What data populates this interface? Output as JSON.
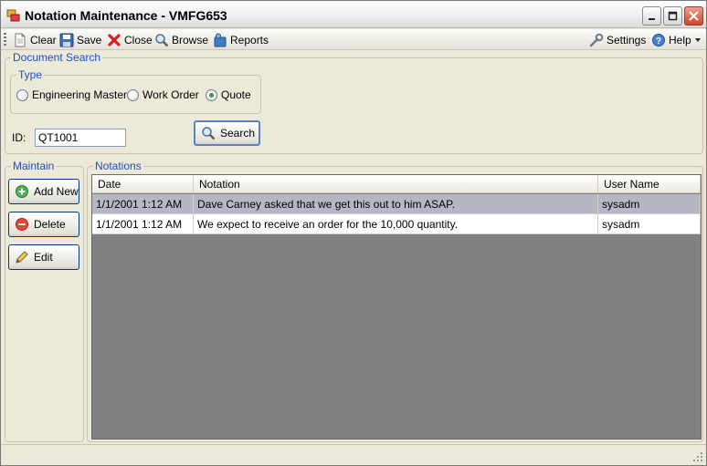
{
  "window": {
    "title": "Notation Maintenance - VMFG653"
  },
  "toolbar": {
    "items": [
      {
        "label": "Clear",
        "icon": "document-icon"
      },
      {
        "label": "Save",
        "icon": "floppy-disk-icon"
      },
      {
        "label": "Close",
        "icon": "red-x-icon"
      },
      {
        "label": "Browse",
        "icon": "magnifier-icon"
      },
      {
        "label": "Reports",
        "icon": "reports-icon"
      }
    ],
    "settings_label": "Settings",
    "help_label": "Help"
  },
  "document_search": {
    "legend": "Document Search",
    "type_legend": "Type",
    "types": [
      {
        "label": "Engineering Master",
        "checked": false
      },
      {
        "label": "Work Order",
        "checked": false
      },
      {
        "label": "Quote",
        "checked": true
      }
    ],
    "id_label": "ID:",
    "id_value": "QT1001",
    "search_label": "Search"
  },
  "maintain": {
    "legend": "Maintain",
    "add_label": "Add New",
    "delete_label": "Delete",
    "edit_label": "Edit"
  },
  "notations": {
    "legend": "Notations",
    "columns": [
      "Date",
      "Notation",
      "User Name"
    ],
    "rows": [
      [
        "1/1/2001 1:12 AM",
        "Dave Carney asked that we get this out to him ASAP.",
        "sysadm"
      ],
      [
        "1/1/2001 1:12 AM",
        "We expect to receive an order for the 10,000 quantity.",
        "sysadm"
      ]
    ],
    "selected_row": 0
  },
  "colors": {
    "legend_blue": "#1f4fbf",
    "grid_empty": "#808080",
    "selected_row": "#b5b7c4"
  }
}
